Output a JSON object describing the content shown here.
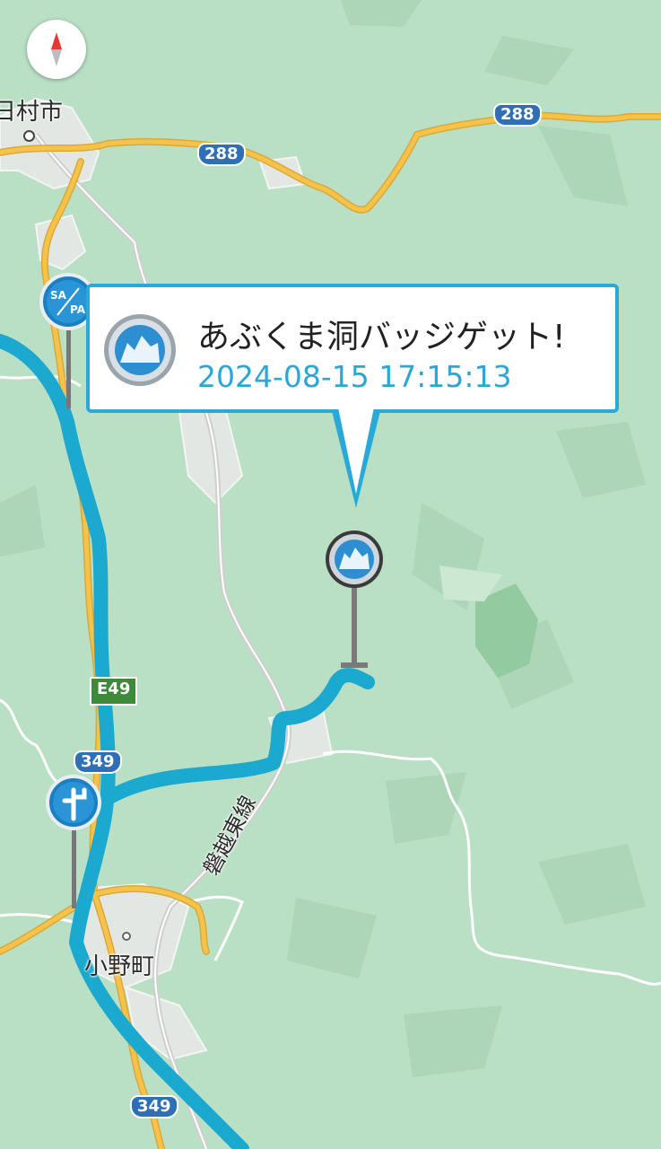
{
  "map": {
    "place_labels": [
      {
        "id": "tamura",
        "text": "日村市"
      },
      {
        "id": "ono",
        "text": "小野町"
      }
    ],
    "route_shields": [
      "288",
      "288",
      "349",
      "349"
    ],
    "expressway_shield": "E49",
    "rail_line_label": "磐越東線",
    "colors": {
      "land": "#b9dfc4",
      "route": "#1ba9cf",
      "highway": "#f6c24a",
      "shield": "#2f6fb6",
      "expressway_shield": "#3f8a3a",
      "callout_accent": "#29a9d8"
    }
  },
  "compass": {
    "icon": "compass-north-icon"
  },
  "callout": {
    "title": "あぶくま洞バッジゲット!",
    "timestamp": "2024-08-15 17:15:13",
    "icon": "badge-mountain-icon"
  },
  "markers": [
    {
      "type": "sa-pa",
      "label": "SA/PA",
      "icon": "sa-pa-icon"
    },
    {
      "type": "junction",
      "icon": "junction-icon"
    },
    {
      "type": "badge",
      "icon": "badge-mountain-icon"
    }
  ]
}
